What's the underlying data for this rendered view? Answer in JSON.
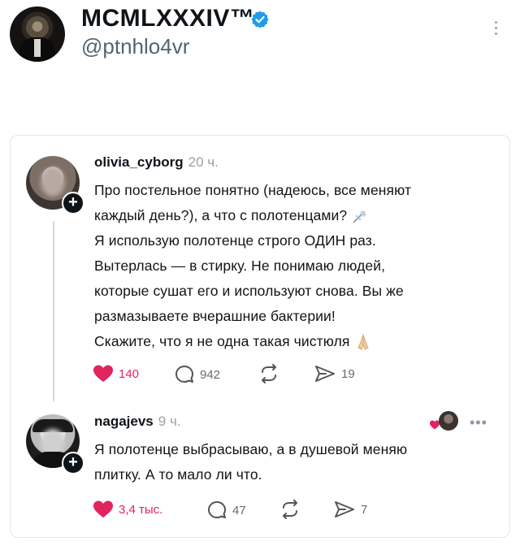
{
  "profile": {
    "display_name": "MCMLXXXIV™",
    "handle": "@ptnhlo4vr",
    "verified": true,
    "icons": [
      "verified-badge-icon",
      "more-vertical-icon"
    ]
  },
  "thread": {
    "posts": [
      {
        "username": "olivia_cyborg",
        "time": "20 ч.",
        "lines": [
          "Про постельное понятно (надеюсь, все меняют",
          "каждый день?), а что с полотенцами?",
          "Я использую полотенце строго ОДИН раз.",
          "Вытерлась — в стирку. Не понимаю людей,",
          "которые сушат его и используют снова. Вы же",
          "размазываете вчерашние бактерии!",
          "Скажите, что я не одна такая чистюля"
        ],
        "emojis": [
          "shower-icon",
          "folded-hands-icon"
        ],
        "likes": "140",
        "comments": "942",
        "shares": "19"
      },
      {
        "username": "nagajevs",
        "time": "9 ч.",
        "lines": [
          "Я полотенце выбрасываю, а в душевой меняю",
          "плитку. А то мало ли что."
        ],
        "likes": "3,4 тыс.",
        "comments": "47",
        "shares": "7"
      }
    ]
  },
  "colors": {
    "like": "#e0245e",
    "verified": "#1d9bf0",
    "secondary_text": "#536471"
  }
}
